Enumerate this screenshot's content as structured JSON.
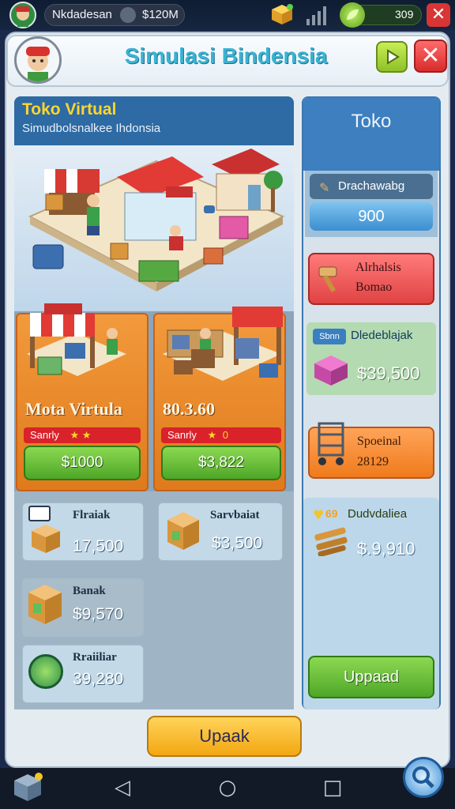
{
  "status_bar": {
    "username": "Nkdadesan",
    "money": "$120M",
    "energy": "309"
  },
  "header": {
    "title": "Simulasi Bindensia"
  },
  "hero": {
    "title": "Toko Virtual",
    "subtitle": "Simudbolsnalkee Ihdonsia"
  },
  "shops": [
    {
      "name": "Mota Virtula",
      "rating_label": "Sanrly",
      "price": "$1000"
    },
    {
      "name": "80.3.60",
      "rating_label": "Sanrly",
      "rating_value": "0",
      "price": "$3,822"
    }
  ],
  "items": [
    {
      "label": "Flraiak",
      "price": "17,500"
    },
    {
      "label": "Sarvbaiat",
      "price": "$3,500"
    },
    {
      "label": "Banak",
      "price": "$9,570"
    },
    {
      "label": "Rraiiliar",
      "price": "39,280"
    }
  ],
  "side_panel": {
    "title": "Toko",
    "card1_label": "Drachawabg",
    "card1_value": "900",
    "card2_line1": "Alrhalsis",
    "card2_line2": "Bomao",
    "card3_badge": "Sbnn",
    "card3_label": "Dledeblajak",
    "card3_price": "$39,500",
    "card4_line1": "Spoeinal",
    "card4_line2": "28129",
    "card5_label": "Dudvdaliea",
    "card5_badge": "69",
    "card5_price": "$.9,910",
    "card5_button": "Uppaad"
  },
  "bottom": {
    "upgrade_button": "Upaak"
  },
  "colors": {
    "title": "#3ab3d4",
    "shop_card": "#f29a3c",
    "green_button": "#5db22f",
    "upgrade_button": "#f7b927",
    "side_header": "#3d7fbf"
  }
}
